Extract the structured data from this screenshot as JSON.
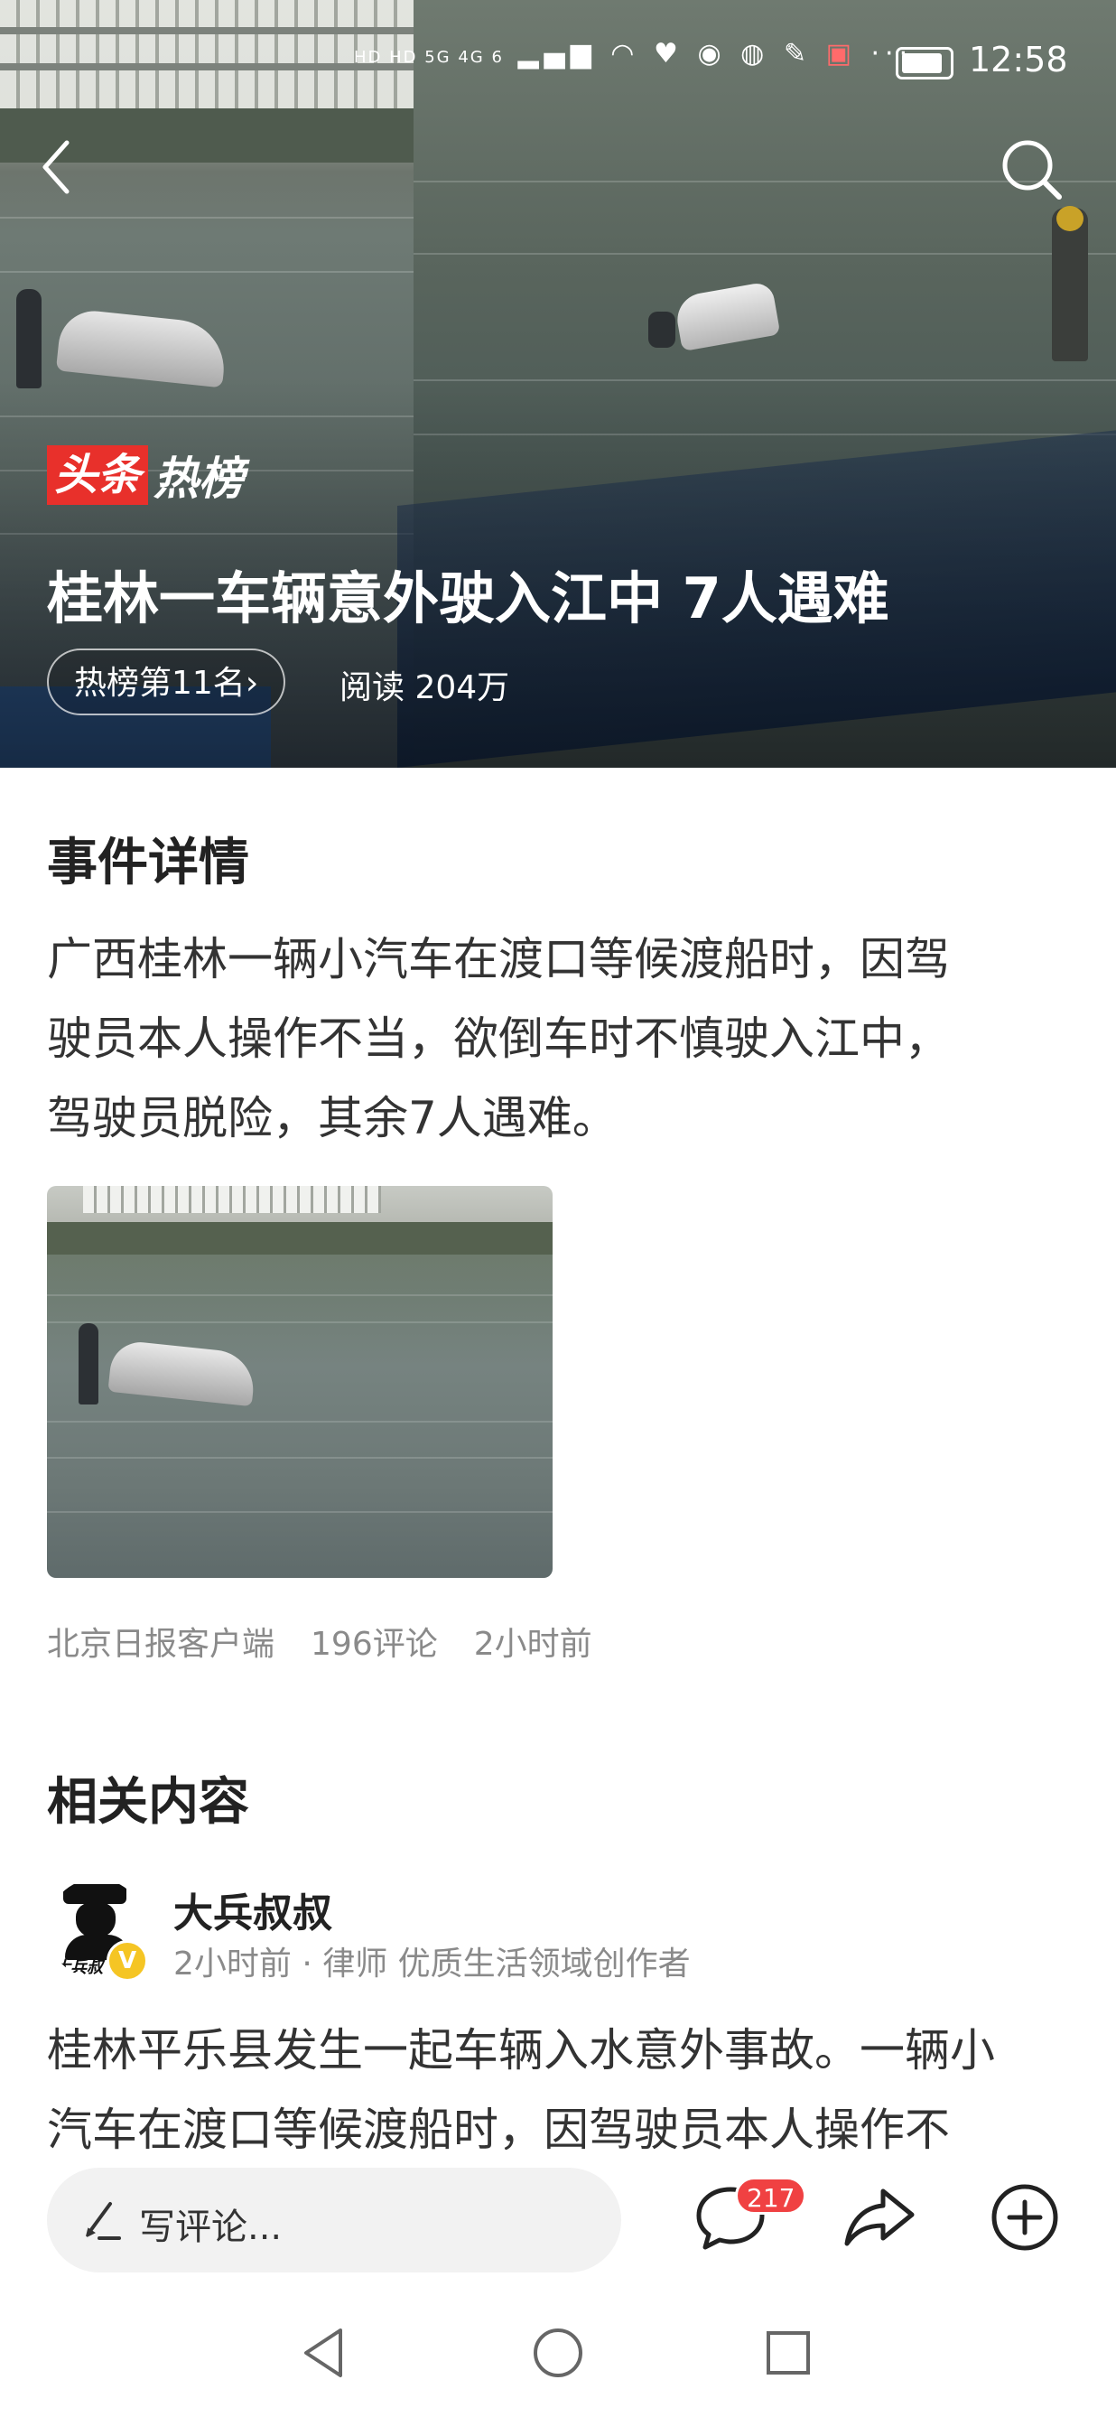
{
  "status_bar": {
    "indicators": "HD HD 5G 4G 6",
    "more": "···",
    "time": "12:58"
  },
  "hero": {
    "brand_box": "头条",
    "brand_text": "热榜",
    "title": "桂林一车辆意外驶入江中 7人遇难",
    "rank": "热榜第11名",
    "reads": "阅读 204万"
  },
  "details": {
    "section_title": "事件详情",
    "body_lines": [
      "广西桂林一辆小汽车在渡口等候渡船时，因驾",
      "驶员本人操作不当，欲倒车时不慎驶入江中，",
      "驾驶员脱险，其余7人遇难。"
    ],
    "source": "北京日报客户端",
    "comments": "196评论",
    "time": "2小时前"
  },
  "related": {
    "section_title": "相关内容",
    "author": {
      "name": "大兵叔叔",
      "avatar_text": "大兵叔",
      "badge": "V",
      "meta": "2小时前 · 律师 优质生活领域创作者"
    },
    "body_lines": [
      "桂林平乐县发生一起车辆入水意外事故。一辆小",
      "汽车在渡口等候渡船时，因驾驶员本人操作不"
    ]
  },
  "action_bar": {
    "comment_placeholder": "写评论...",
    "comment_count": "217",
    "icons": [
      "pen-icon",
      "comment-icon",
      "share-icon",
      "add-icon"
    ]
  },
  "nav_bar": {
    "icons": [
      "back-triangle-icon",
      "home-circle-icon",
      "recents-square-icon"
    ]
  },
  "colors": {
    "brand_red": "#e8302b",
    "badge_red": "#f04142",
    "verified_yellow": "#f5c524",
    "meta_gray": "#8a8a8a"
  }
}
